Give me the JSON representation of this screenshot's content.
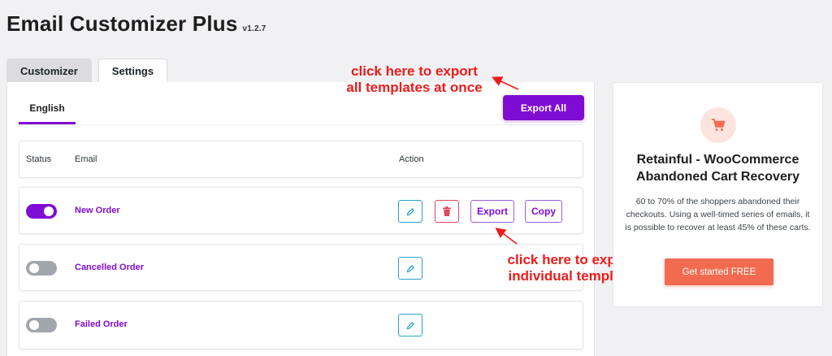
{
  "page": {
    "title": "Email Customizer Plus",
    "version": "v1.2.7"
  },
  "tabs": [
    {
      "label": "Customizer",
      "active": true
    },
    {
      "label": "Settings",
      "active": false
    }
  ],
  "language_tab": {
    "label": "English"
  },
  "export_all_label": "Export All",
  "table": {
    "headers": {
      "status": "Status",
      "email": "Email",
      "action": "Action"
    },
    "rows": [
      {
        "name": "New Order",
        "enabled": true,
        "actions": [
          "edit",
          "delete",
          "Export",
          "Copy"
        ]
      },
      {
        "name": "Cancelled Order",
        "enabled": false,
        "actions": [
          "edit"
        ]
      },
      {
        "name": "Failed Order",
        "enabled": false,
        "actions": [
          "edit"
        ]
      }
    ],
    "export_label": "Export",
    "copy_label": "Copy"
  },
  "annotations": {
    "export_all": [
      "click here to export",
      "all templates at once"
    ],
    "export_single": [
      "click here to export",
      "individual template"
    ]
  },
  "promo": {
    "icon": "shopping-cart-icon",
    "title": "Retainful - WooCommerce Abandoned Cart Recovery",
    "description": "60 to 70% of the shoppers abandoned their checkouts. Using a well-timed series of emails, it is possible to recover at least 45% of these carts.",
    "button_label": "Get started FREE"
  },
  "colors": {
    "accent": "#7f0cd3",
    "annotation": "#ee1b1b",
    "promo_button": "#f26b50",
    "edit_border": "#26a3c8",
    "delete": "#e0465e"
  }
}
